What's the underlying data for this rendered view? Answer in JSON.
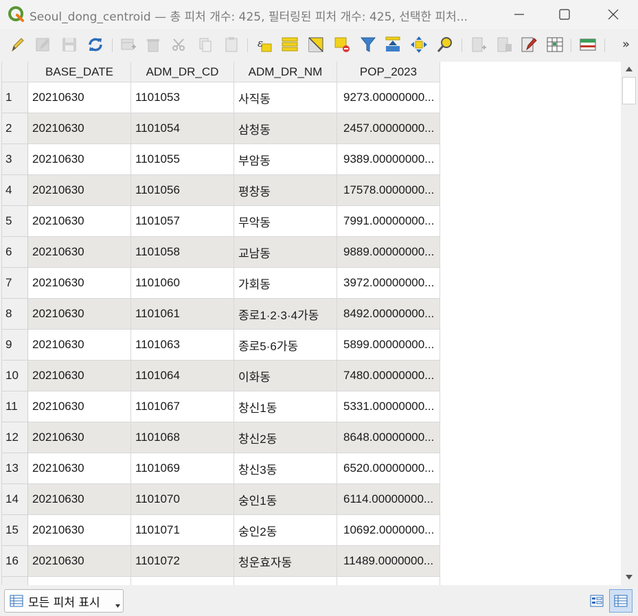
{
  "window": {
    "title": "Seoul_dong_centroid — 총 피처 개수: 425, 필터링된 피처 개수: 425, 선택한 피처..."
  },
  "icons": [
    "edit-pencil-icon",
    "multi-edit-icon",
    "save-icon",
    "reload-icon",
    "add-feature-icon",
    "delete-feature-icon",
    "cut-icon",
    "copy-icon",
    "paste-icon",
    "expression-select-icon",
    "select-all-icon",
    "invert-selection-icon",
    "deselect-icon",
    "filter-icon",
    "move-selection-top-icon",
    "pan-to-selection-icon",
    "zoom-to-selection-icon",
    "new-field-icon",
    "delete-field-icon",
    "field-calculator-icon",
    "conditional-format-icon",
    "dock-icon",
    "overflow-icon"
  ],
  "table": {
    "columns": [
      "BASE_DATE",
      "ADM_DR_CD",
      "ADM_DR_NM",
      "POP_2023"
    ],
    "rows": [
      [
        "1",
        "20210630",
        "1101053",
        "사직동",
        "9273.00000000..."
      ],
      [
        "2",
        "20210630",
        "1101054",
        "삼청동",
        "2457.00000000..."
      ],
      [
        "3",
        "20210630",
        "1101055",
        "부암동",
        "9389.00000000..."
      ],
      [
        "4",
        "20210630",
        "1101056",
        "평창동",
        "17578.0000000..."
      ],
      [
        "5",
        "20210630",
        "1101057",
        "무악동",
        "7991.00000000..."
      ],
      [
        "6",
        "20210630",
        "1101058",
        "교남동",
        "9889.00000000..."
      ],
      [
        "7",
        "20210630",
        "1101060",
        "가회동",
        "3972.00000000..."
      ],
      [
        "8",
        "20210630",
        "1101061",
        "종로1·2·3·4가동",
        "8492.00000000..."
      ],
      [
        "9",
        "20210630",
        "1101063",
        "종로5·6가동",
        "5899.00000000..."
      ],
      [
        "10",
        "20210630",
        "1101064",
        "이화동",
        "7480.00000000..."
      ],
      [
        "11",
        "20210630",
        "1101067",
        "창신1동",
        "5331.00000000..."
      ],
      [
        "12",
        "20210630",
        "1101068",
        "창신2동",
        "8648.00000000..."
      ],
      [
        "13",
        "20210630",
        "1101069",
        "창신3동",
        "6520.00000000..."
      ],
      [
        "14",
        "20210630",
        "1101070",
        "숭인1동",
        "6114.00000000..."
      ],
      [
        "15",
        "20210630",
        "1101071",
        "숭인2동",
        "10692.0000000..."
      ],
      [
        "16",
        "20210630",
        "1101072",
        "청운효자동",
        "11489.0000000..."
      ]
    ]
  },
  "footer": {
    "show_all_label": "모든 피처 표시"
  },
  "colors": {
    "alt_row": "#e8e7e4",
    "header_bg": "#f0f0f0",
    "qgis_green": "#589632"
  }
}
